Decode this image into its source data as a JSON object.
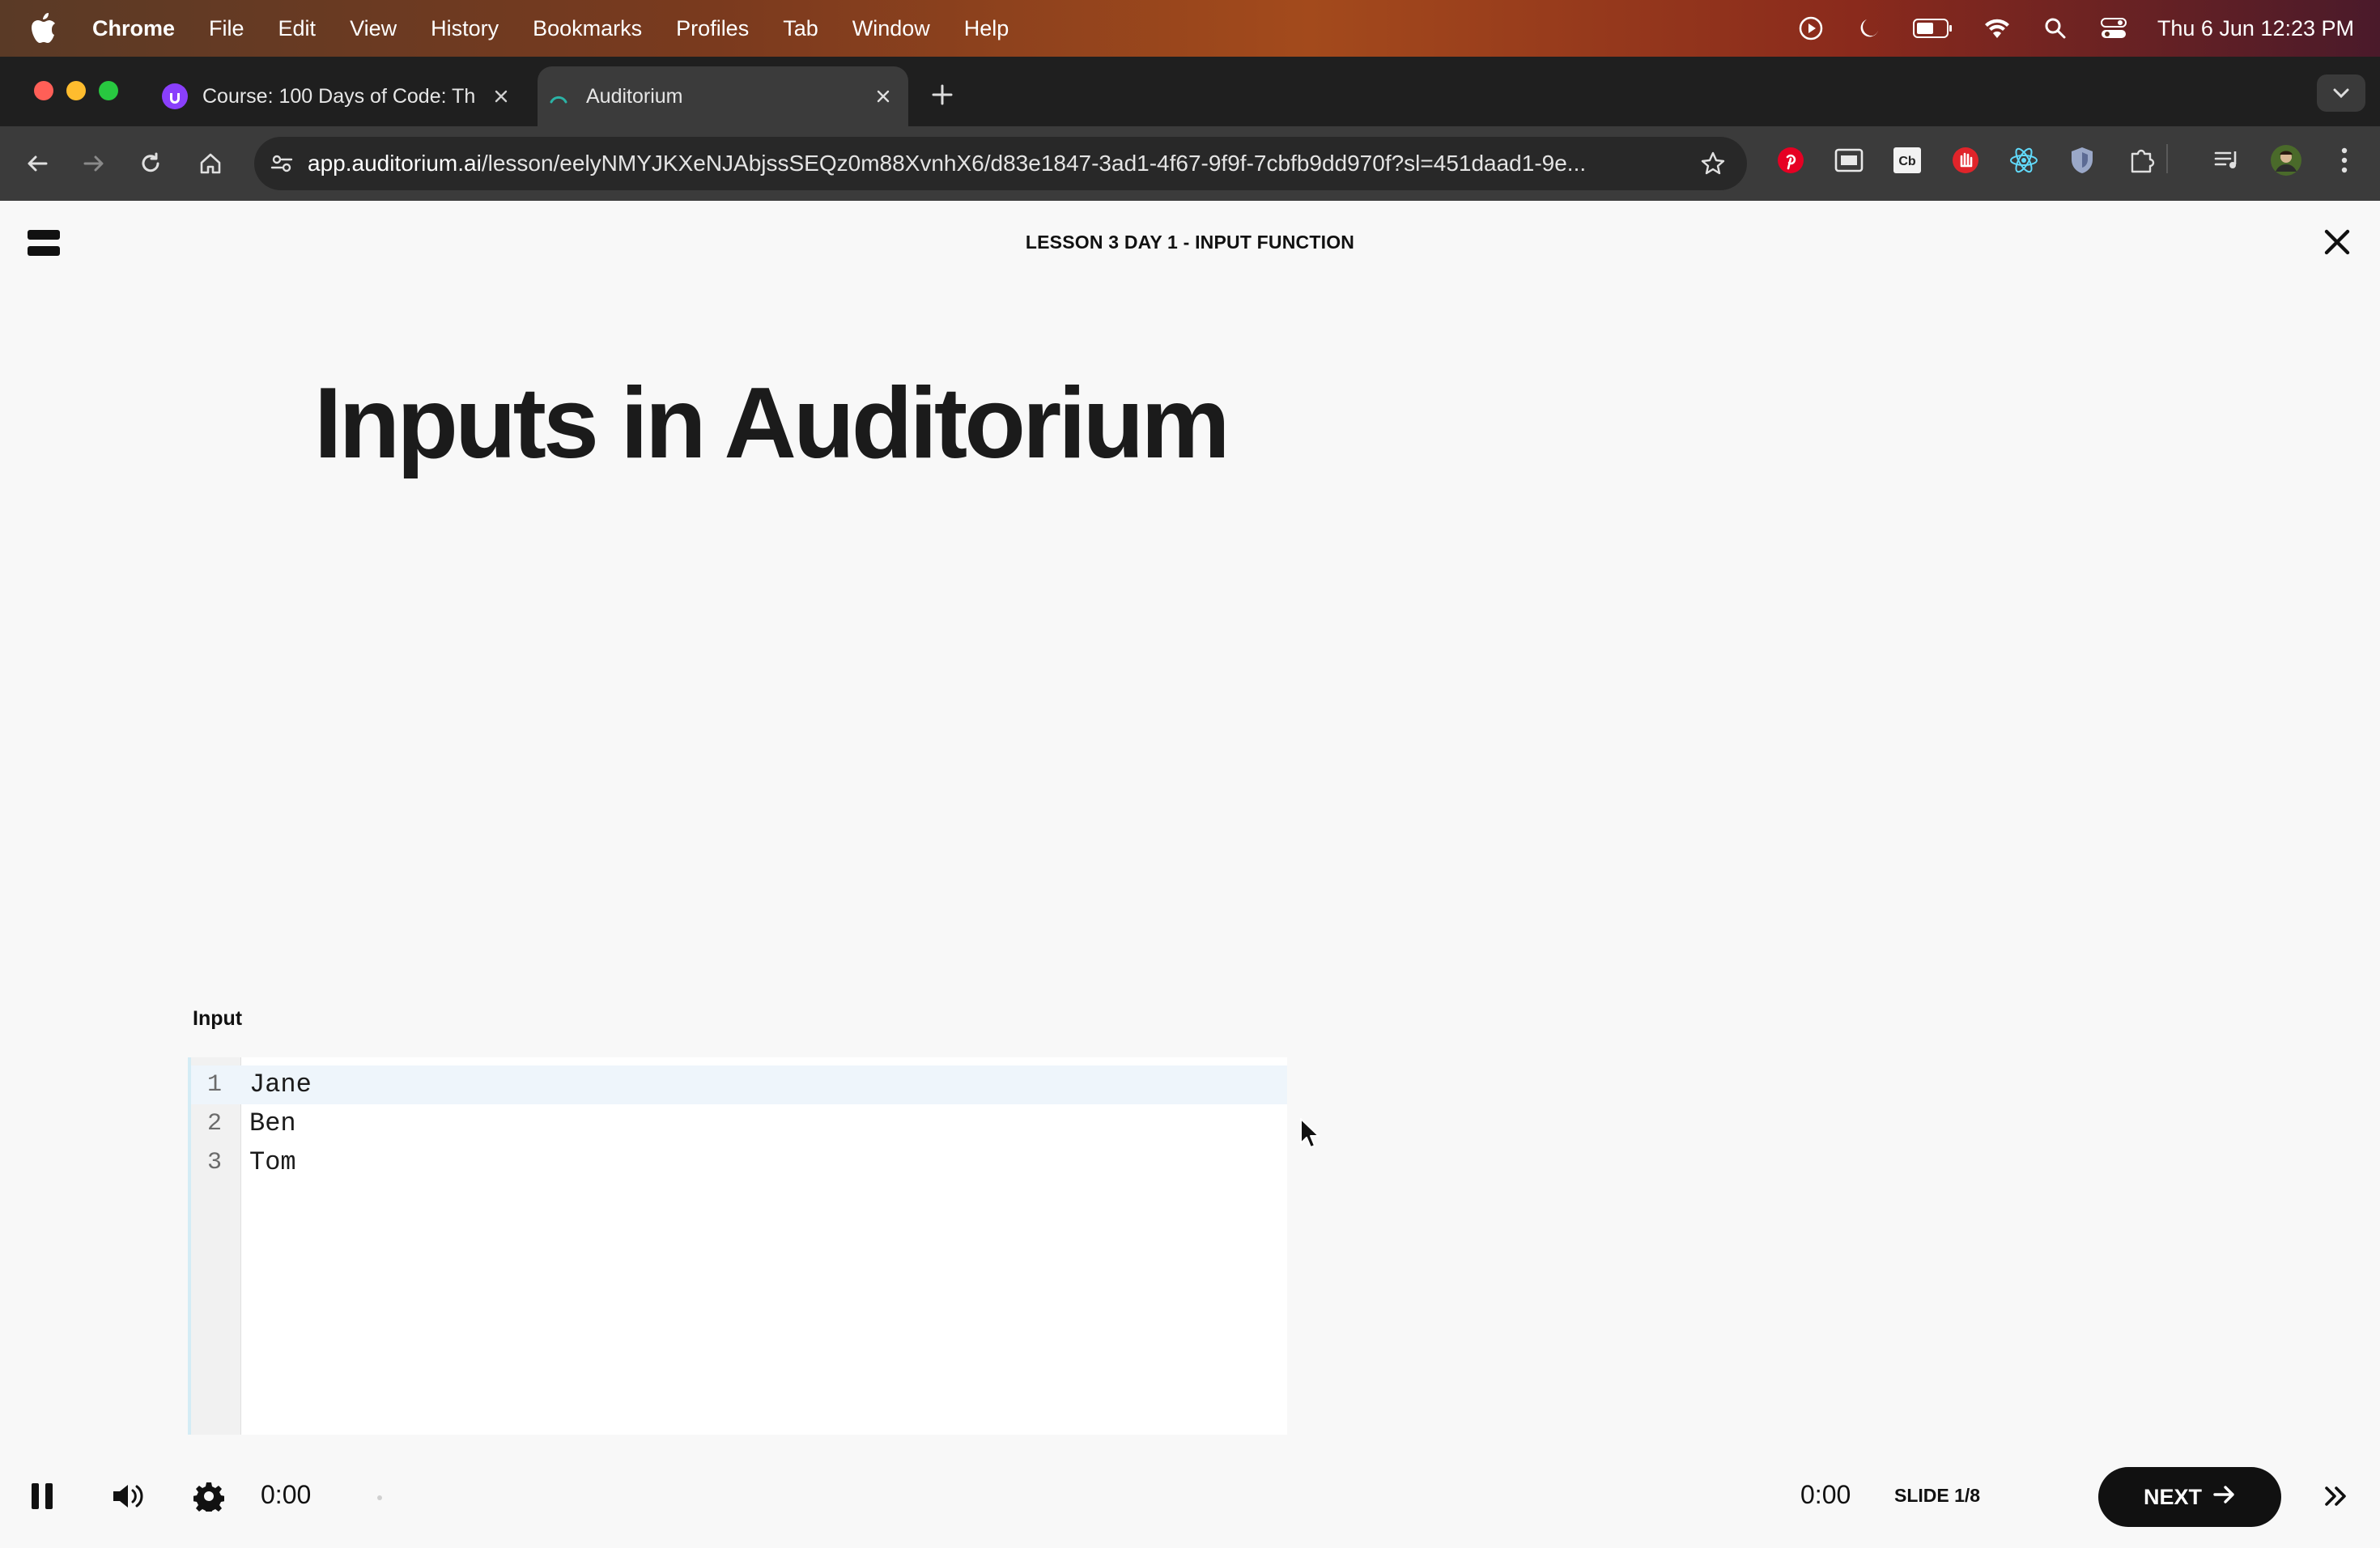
{
  "menubar": {
    "app": "Chrome",
    "items": [
      "File",
      "Edit",
      "View",
      "History",
      "Bookmarks",
      "Profiles",
      "Tab",
      "Window",
      "Help"
    ],
    "clock": "Thu 6 Jun  12:23 PM"
  },
  "tabs": [
    {
      "title": "Course: 100 Days of Code: Th",
      "active": false
    },
    {
      "title": "Auditorium",
      "active": true
    }
  ],
  "toolbar": {
    "url_host": "app.auditorium.ai",
    "url_path": "/lesson/eelyNMYJKXeNJAbjssSEQz0m88XvnhX6/d83e1847-3ad1-4f67-9f9f-7cbfb9dd970f?sl=451daad1-9e..."
  },
  "lesson": {
    "title": "LESSON 3 DAY 1 - INPUT FUNCTION",
    "heading": "Inputs in Auditorium"
  },
  "editor": {
    "label": "Input",
    "lines": [
      {
        "num": "1",
        "text": "Jane"
      },
      {
        "num": "2",
        "text": "Ben"
      },
      {
        "num": "3",
        "text": "Tom"
      }
    ]
  },
  "player": {
    "elapsed": "0:00",
    "remaining": "0:00",
    "slide": "SLIDE 1/8",
    "next_label": "NEXT"
  },
  "colors": {
    "menubar_accent": "#a34a1c",
    "next_button": "#111111",
    "tab_favicon_course": "#8a3ffc",
    "tab_favicon_auditorium": "#2bb3a6"
  }
}
